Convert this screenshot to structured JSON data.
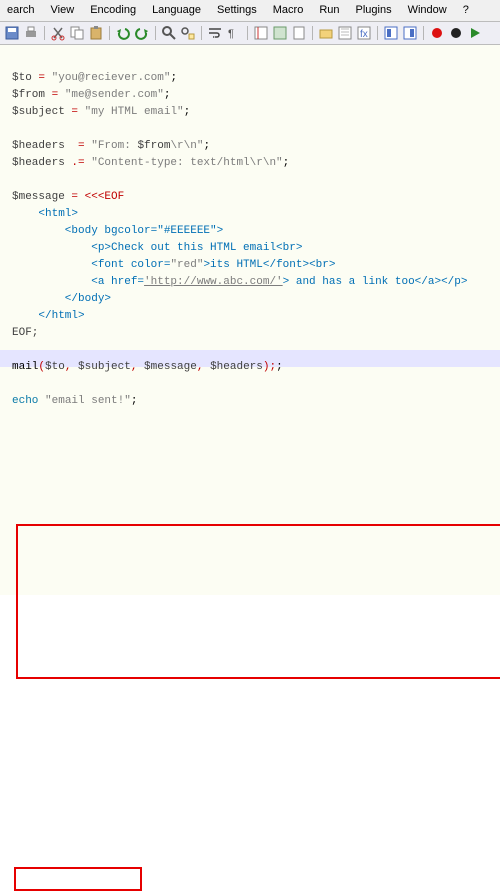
{
  "menubar": {
    "items": [
      "earch",
      "View",
      "Encoding",
      "Language",
      "Settings",
      "Macro",
      "Run",
      "Plugins",
      "Window",
      "?"
    ]
  },
  "toolbar": {
    "icons": [
      {
        "name": "save-icon"
      },
      {
        "name": "print-icon"
      },
      {
        "name": "cut-icon"
      },
      {
        "name": "copy-icon"
      },
      {
        "name": "paste-icon"
      },
      {
        "name": "undo-icon"
      },
      {
        "name": "redo-icon"
      },
      {
        "name": "find-icon"
      },
      {
        "name": "replace-icon"
      },
      {
        "name": "wrap-icon"
      },
      {
        "name": "invisible-icon"
      },
      {
        "name": "indent-guide-icon"
      },
      {
        "name": "lang-icon"
      },
      {
        "name": "doc-icon"
      },
      {
        "name": "folder-icon"
      },
      {
        "name": "map-icon"
      },
      {
        "name": "func-icon"
      },
      {
        "name": "toggle1-icon"
      },
      {
        "name": "toggle2-icon"
      },
      {
        "name": "record-red-icon"
      },
      {
        "name": "record-black-icon"
      },
      {
        "name": "play-icon"
      }
    ]
  },
  "code": {
    "l1a": "$to",
    "l1b": " = ",
    "l1c": "\"you@reciever.com\"",
    "l2a": "$from",
    "l2b": " = ",
    "l2c": "\"me@sender.com\"",
    "l3a": "$subject",
    "l3b": " = ",
    "l3c": "\"my HTML email\"",
    "l5a": "$headers",
    "l5b": "  = ",
    "l5c": "\"From: ",
    "l5d": "$from",
    "l5e": "\\r\\n\"",
    "l6a": "$headers",
    "l6b": " .= ",
    "l6c": "\"Content-type: text/html\\r\\n\"",
    "l8a": "$message",
    "l8b": " = <<<EOF",
    "l9": "    <html>",
    "l10": "        <body bgcolor=\"#EEEEEE\">",
    "l11": "            <p>Check out this HTML email<br>",
    "l12a": "            <font color=",
    "l12b": "\"red\"",
    "l12c": ">its HTML</font><br>",
    "l13a": "            <a href=",
    "l13b": "'http://www.abc.com/'",
    "l13c": "> and has a link too</a></p>",
    "l14": "        </body>",
    "l15": "    </html>",
    "l16": "EOF;",
    "l18a": "mail",
    "l18b": "(",
    "l18c": "$to",
    "l18d": ", ",
    "l18e": "$subject",
    "l18f": ", ",
    "l18g": "$message",
    "l18h": ", ",
    "l18i": "$headers",
    "l18j": ");",
    "l20a": "echo",
    "l20b": " ",
    "l20c": "\"email sent!\"",
    "semi": ";"
  }
}
